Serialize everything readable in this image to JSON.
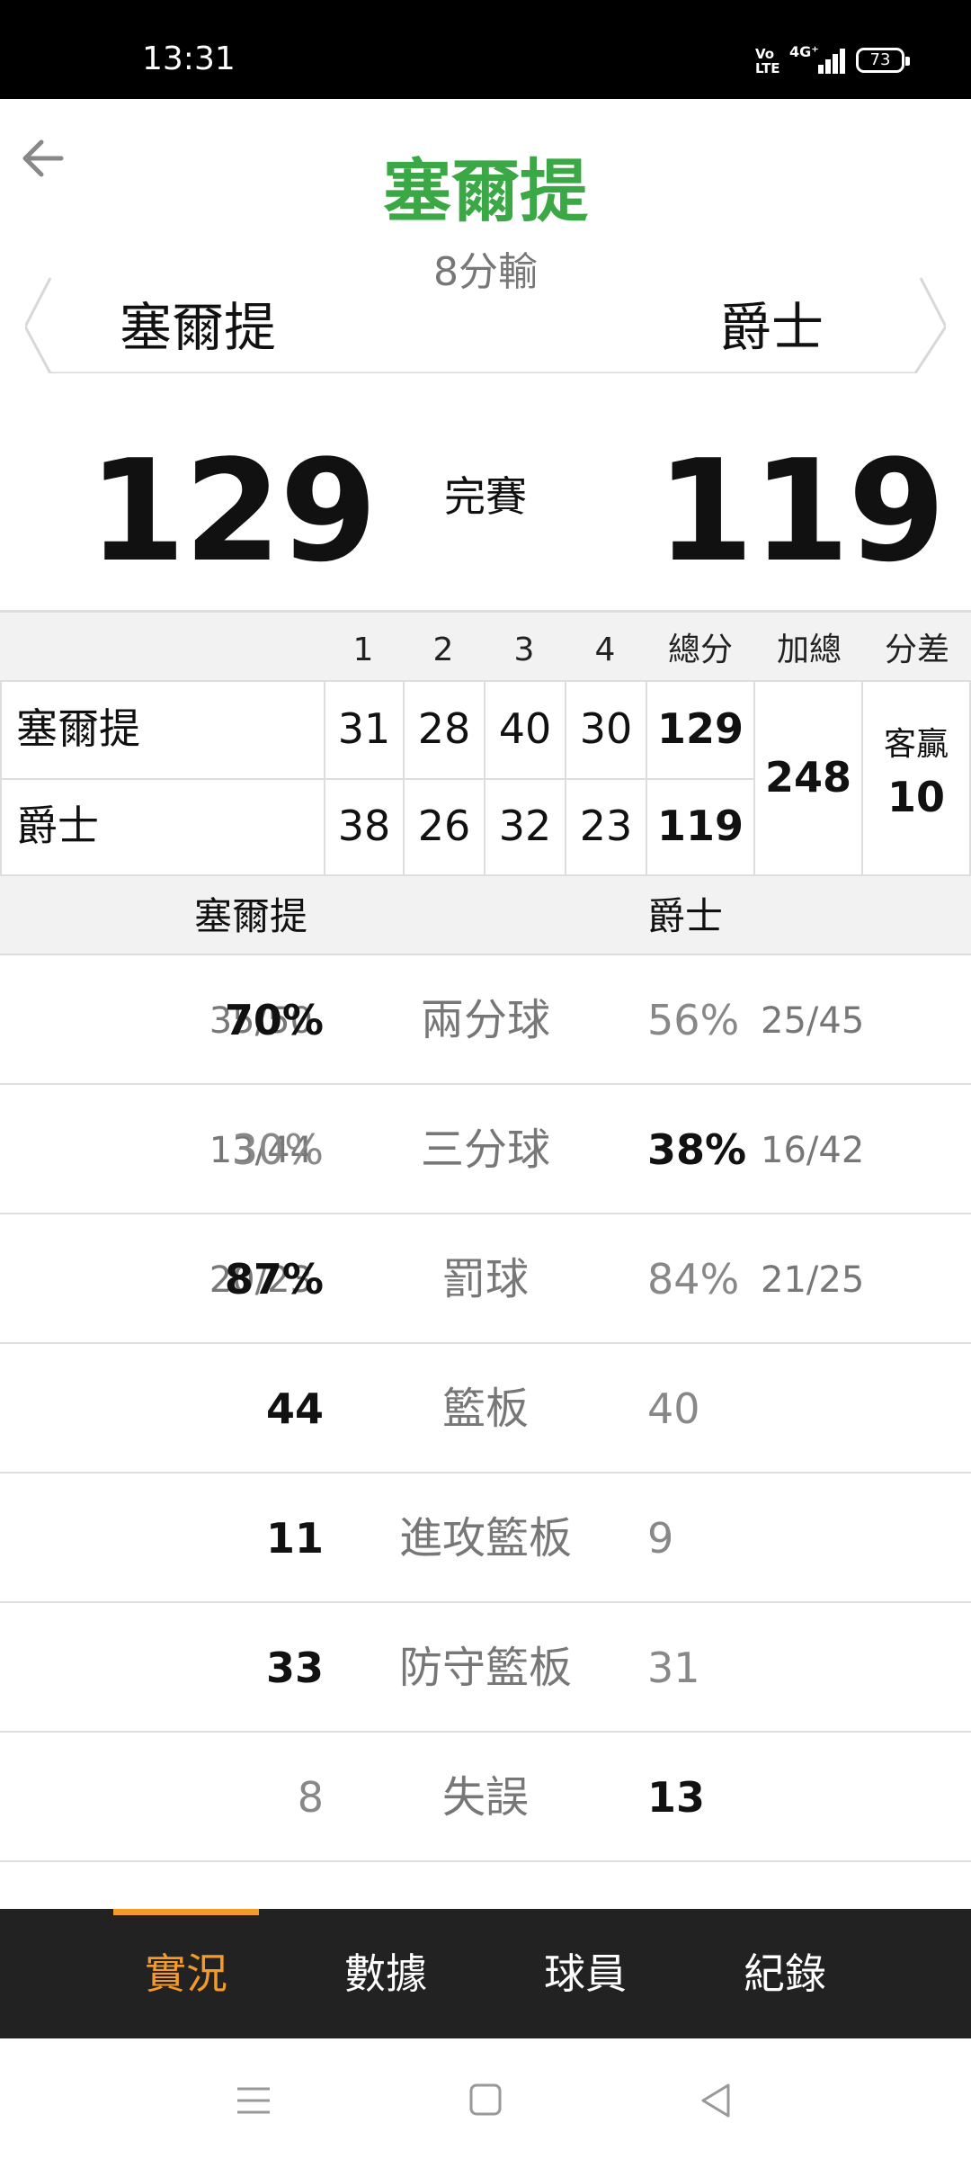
{
  "status_bar": {
    "time": "13:31",
    "volte": "Vo LTE",
    "network": "4G⁺",
    "battery": "73"
  },
  "header": {
    "title": "塞爾提",
    "subtitle": "8分輸",
    "team_left": "塞爾提",
    "team_right": "爵士"
  },
  "score": {
    "left": "129",
    "status": "完賽",
    "right": "119"
  },
  "quarters": {
    "headers": [
      "1",
      "2",
      "3",
      "4",
      "總分",
      "加總",
      "分差"
    ],
    "rows": [
      {
        "team": "塞爾提",
        "q": [
          "31",
          "28",
          "40",
          "30"
        ],
        "total": "129"
      },
      {
        "team": "爵士",
        "q": [
          "38",
          "26",
          "32",
          "23"
        ],
        "total": "119"
      }
    ],
    "combined": "248",
    "spread_label": "客贏",
    "spread_value": "10"
  },
  "stats": {
    "team_left": "塞爾提",
    "team_right": "爵士",
    "rows": [
      {
        "label": "兩分球",
        "left_frac": "35/50",
        "left": "70%",
        "right": "56%",
        "right_frac": "25/45",
        "winner": "left"
      },
      {
        "label": "三分球",
        "left_frac": "13/44",
        "left": "30%",
        "right": "38%",
        "right_frac": "16/42",
        "winner": "right"
      },
      {
        "label": "罰球",
        "left_frac": "20/23",
        "left": "87%",
        "right": "84%",
        "right_frac": "21/25",
        "winner": "left"
      },
      {
        "label": "籃板",
        "left_frac": "",
        "left": "44",
        "right": "40",
        "right_frac": "",
        "winner": "left"
      },
      {
        "label": "進攻籃板",
        "left_frac": "",
        "left": "11",
        "right": "9",
        "right_frac": "",
        "winner": "left"
      },
      {
        "label": "防守籃板",
        "left_frac": "",
        "left": "33",
        "right": "31",
        "right_frac": "",
        "winner": "left"
      },
      {
        "label": "失誤",
        "left_frac": "",
        "left": "8",
        "right": "13",
        "right_frac": "",
        "winner": "right"
      }
    ]
  },
  "tabs": [
    {
      "label": "實況",
      "active": true
    },
    {
      "label": "數據",
      "active": false
    },
    {
      "label": "球員",
      "active": false
    },
    {
      "label": "紀錄",
      "active": false
    }
  ],
  "colors": {
    "title_green": "#3aa845",
    "tab_accent": "#f49a2a",
    "tabbar_bg": "#222222"
  },
  "icons": {
    "back": "arrow-left-icon",
    "menu": "menu-icon",
    "home": "home-square-icon",
    "back_nav": "triangle-back-icon"
  }
}
